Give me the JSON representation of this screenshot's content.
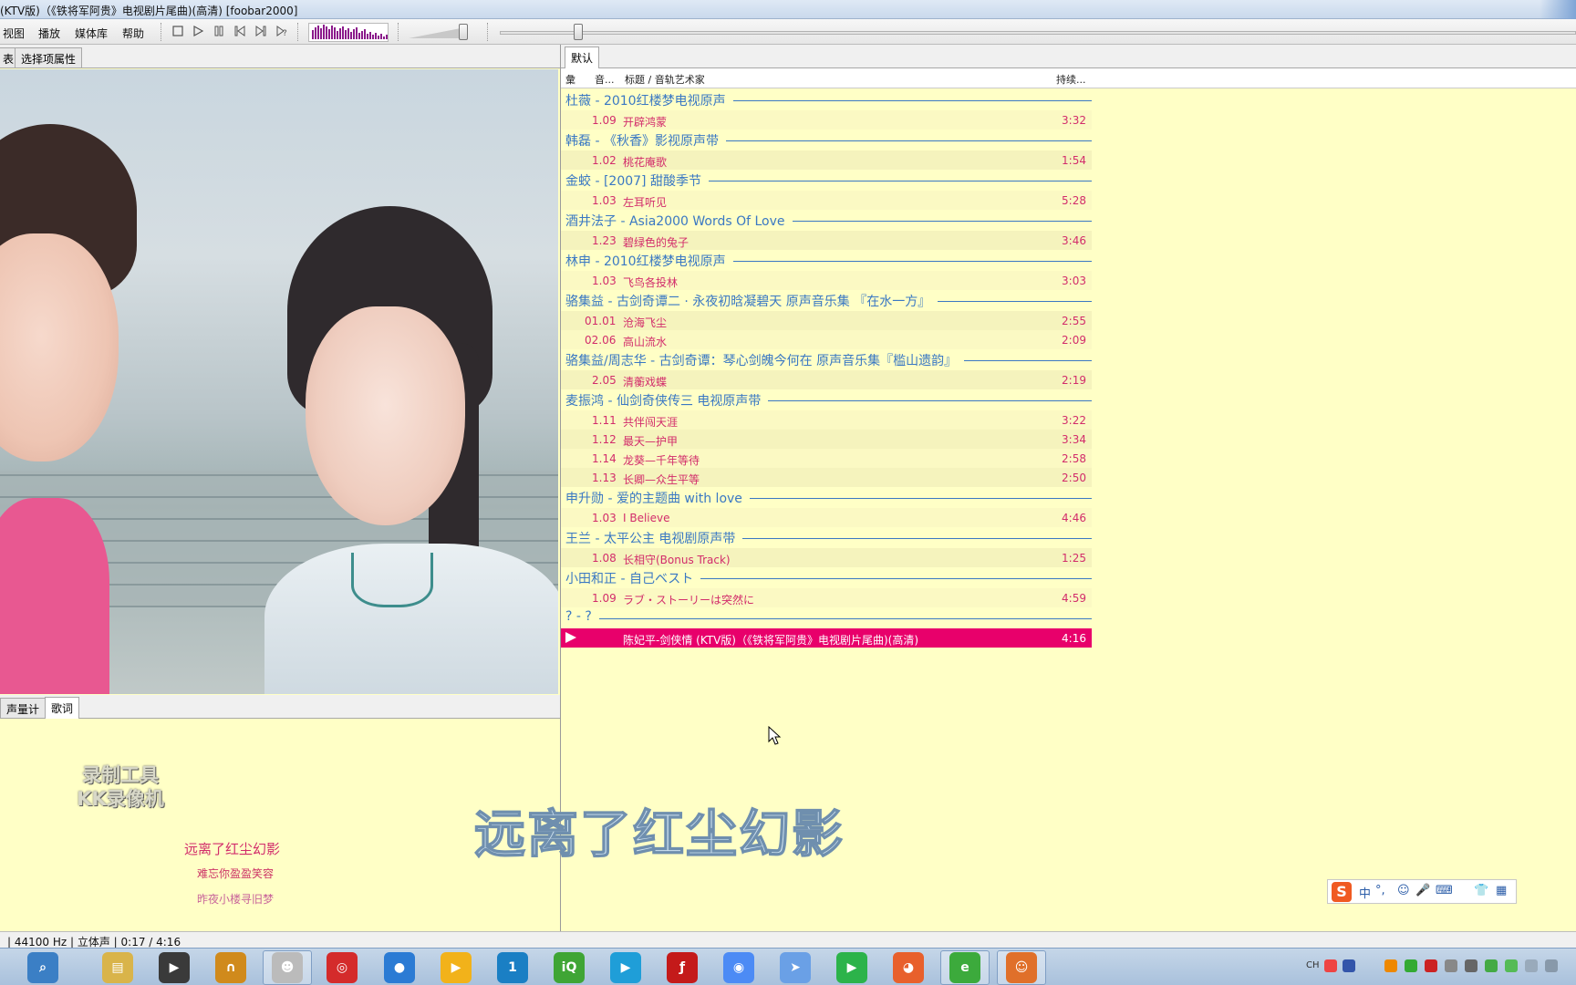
{
  "window": {
    "title": "(KTV版)（《铁将军阿贵》电视剧片尾曲)(高清)  [foobar2000]"
  },
  "menu": {
    "items": [
      "视图",
      "播放",
      "媒体库",
      "帮助"
    ]
  },
  "transport": {
    "stop_icon": "stop-icon",
    "play_icon": "play-icon",
    "pause_icon": "pause-icon",
    "prev_icon": "previous-icon",
    "next_icon": "next-icon",
    "random_icon": "random-icon"
  },
  "left_tabs": {
    "tab1": "表",
    "tab2": "选择项属性"
  },
  "bottom_tabs": {
    "tab1": "声量计",
    "tab2": "歌词"
  },
  "lyrics": {
    "watermark_line1": "录制工具",
    "watermark_line2": "KK录像机",
    "current": "远离了红尘幻影",
    "next1": "难忘你盈盈笑容",
    "next2": "昨夜小楼寻旧梦",
    "big_subtitle": "远离了红尘幻影",
    "current_color": "#d22c6b",
    "next_color": "#cc3366"
  },
  "playlist": {
    "tab": "默认",
    "columns": {
      "c1": "彙",
      "c2": "音...",
      "c3": "标题 / 音轨艺术家",
      "c4": "持续..."
    },
    "groups": [
      {
        "title": "杜薇 - 2010红楼梦电视原声",
        "tracks": [
          {
            "num": "1.09",
            "title": "开辟鸿蒙",
            "dur": "3:32"
          }
        ]
      },
      {
        "title": "韩磊 - 《秋香》影视原声带",
        "tracks": [
          {
            "num": "1.02",
            "title": "桃花庵歌",
            "dur": "1:54"
          }
        ]
      },
      {
        "title": "金蛟 - [2007] 甜酸季节",
        "tracks": [
          {
            "num": "1.03",
            "title": "左耳听见",
            "dur": "5:28"
          }
        ]
      },
      {
        "title": "酒井法子 - Asia2000 Words Of Love",
        "tracks": [
          {
            "num": "1.23",
            "title": "碧绿色的兔子",
            "dur": "3:46"
          }
        ]
      },
      {
        "title": "林申 - 2010红楼梦电视原声",
        "tracks": [
          {
            "num": "1.03",
            "title": "飞鸟各投林",
            "dur": "3:03"
          }
        ]
      },
      {
        "title": "骆集益 - 古剑奇谭二 · 永夜初晗凝碧天 原声音乐集 『在水一方』",
        "tracks": [
          {
            "num": "01.01",
            "title": "沧海飞尘",
            "dur": "2:55"
          },
          {
            "num": "02.06",
            "title": "高山流水",
            "dur": "2:09"
          }
        ]
      },
      {
        "title": "骆集益/周志华 - 古剑奇谭：琴心剑魄今何在 原声音乐集『槛山遗韵』",
        "tracks": [
          {
            "num": "2.05",
            "title": "清蘅戏蝶",
            "dur": "2:19"
          }
        ]
      },
      {
        "title": "麦振鸿 - 仙剑奇侠传三 电视原声带",
        "tracks": [
          {
            "num": "1.11",
            "title": "共伴闯天涯",
            "dur": "3:22"
          },
          {
            "num": "1.12",
            "title": "最天—护甲",
            "dur": "3:34"
          },
          {
            "num": "1.14",
            "title": "龙葵—千年等待",
            "dur": "2:58"
          },
          {
            "num": "1.13",
            "title": "长卿—众生平等",
            "dur": "2:50"
          }
        ]
      },
      {
        "title": "申升勋 - 爱的主题曲 with love",
        "tracks": [
          {
            "num": "1.03",
            "title": "I Believe",
            "dur": "4:46"
          }
        ]
      },
      {
        "title": "王兰 - 太平公主 电视剧原声带",
        "tracks": [
          {
            "num": "1.08",
            "title": "长相守(Bonus Track)",
            "dur": "1:25"
          }
        ]
      },
      {
        "title": "小田和正 - 自己ベスト",
        "tracks": [
          {
            "num": "1.09",
            "title": "ラブ・ストーリーは突然に",
            "dur": "4:59"
          }
        ]
      },
      {
        "title": "? - ?",
        "tracks": [
          {
            "num": "",
            "title": "陈妃平-剑侠情 (KTV版)（《铁将军阿贵》电视剧片尾曲)(高清)",
            "dur": "4:16",
            "playing": true
          }
        ]
      }
    ]
  },
  "status": {
    "text": "| 44100 Hz | 立体声 | 0:17 / 4:16"
  },
  "ime": {
    "logo": "S",
    "mode": "中",
    "punct": "°,",
    "items": [
      "☺",
      "🎤",
      "⌨",
      "👕",
      "▦"
    ]
  },
  "tray": {
    "lang": "CH"
  },
  "colors": {
    "group_blue": "#3a78c3",
    "track_pink": "#d22c6b",
    "playing_bg": "#e8006b",
    "panel_bg": "#ffffc6"
  }
}
